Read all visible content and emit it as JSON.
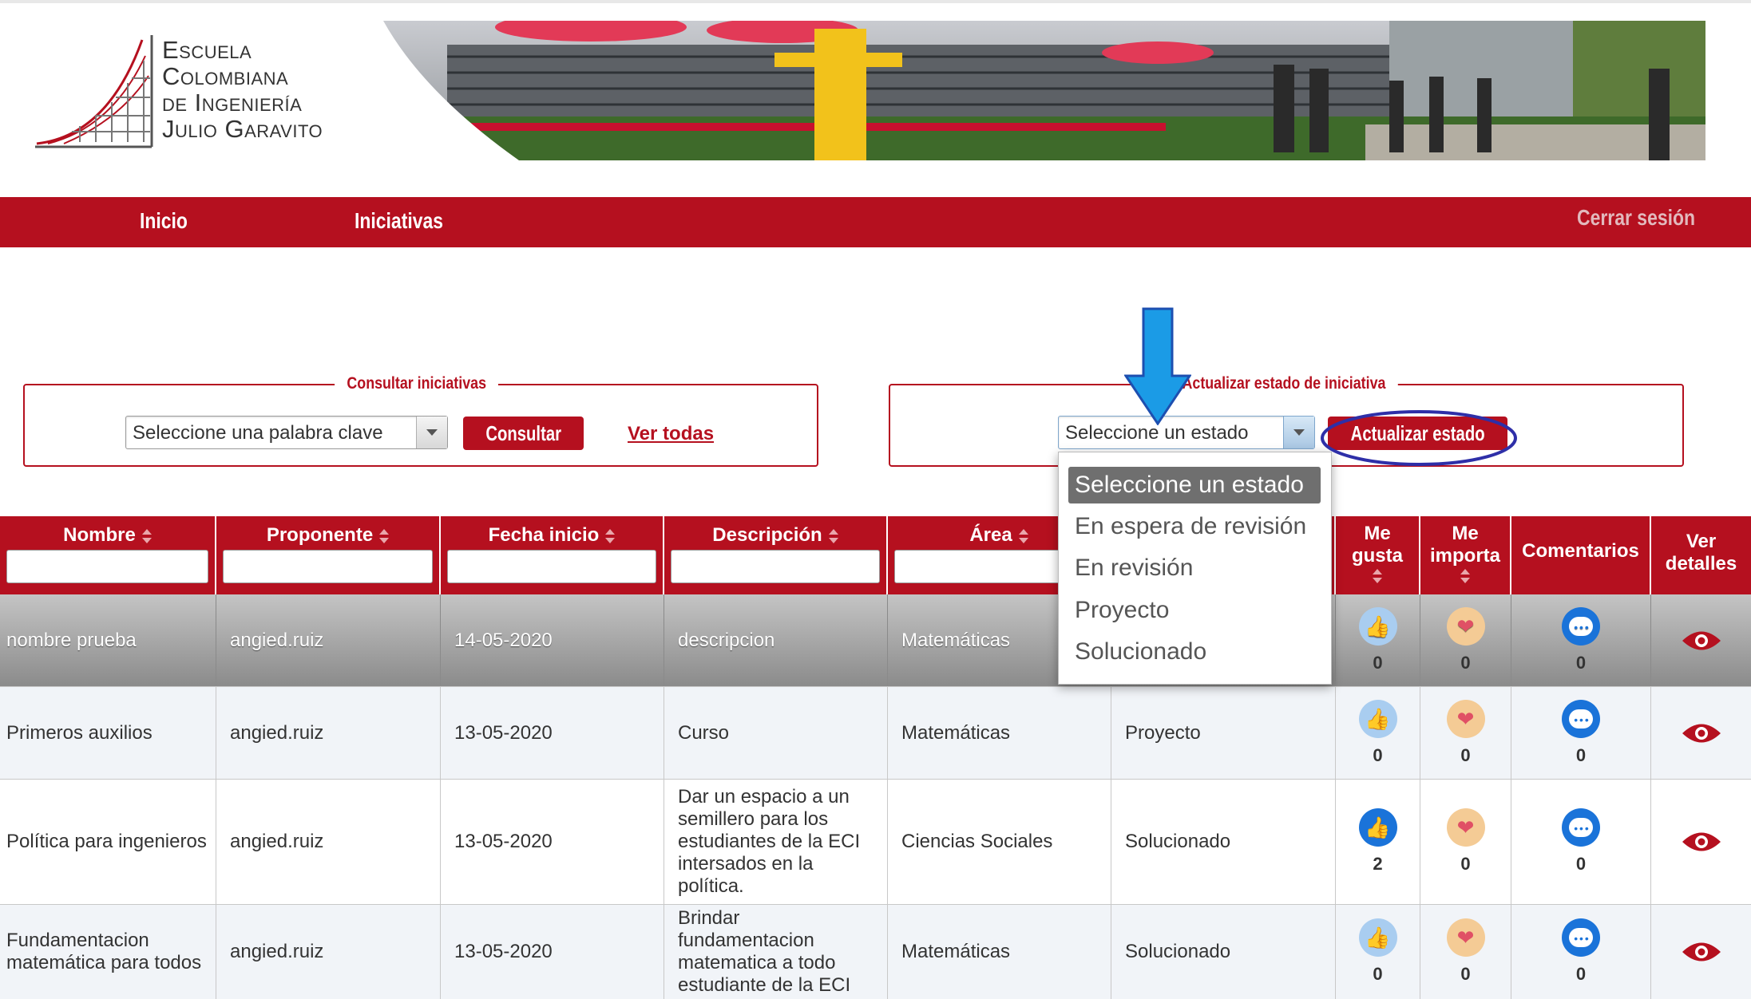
{
  "header": {
    "logo_lines": [
      "Escuela",
      "Colombiana",
      "de Ingeniería",
      "Julio Garavito"
    ]
  },
  "nav": {
    "inicio": "Inicio",
    "iniciativas": "Iniciativas",
    "cerrar_sesion": "Cerrar sesión"
  },
  "consultar": {
    "legend": "Consultar iniciativas",
    "select_value": "Seleccione una palabra clave",
    "button": "Consultar",
    "link": "Ver todas"
  },
  "actualizar": {
    "legend": "Actualizar estado de iniciativa",
    "select_value": "Seleccione un estado",
    "button": "Actualizar estado"
  },
  "dropdown": {
    "options": [
      "Seleccione un estado",
      "En espera de revisión",
      "En revisión",
      "Proyecto",
      "Solucionado"
    ],
    "highlighted": 0
  },
  "table": {
    "headers": {
      "nombre": "Nombre",
      "proponente": "Proponente",
      "fecha": "Fecha inicio",
      "descripcion": "Descripción",
      "area": "Área",
      "megusta_1": "Me",
      "megusta_2": "gusta",
      "meimporta_1": "Me",
      "meimporta_2": "importa",
      "comentarios": "Comentarios",
      "ver_1": "Ver",
      "ver_2": "detalles"
    },
    "rows": [
      {
        "nombre": "nombre prueba",
        "proponente": "angied.ruiz",
        "fecha": "14-05-2020",
        "descripcion": "descripcion",
        "area": "Matemáticas",
        "estado": "",
        "me_gusta": "0",
        "me_importa": "0",
        "comentarios": "0"
      },
      {
        "nombre": "Primeros auxilios",
        "proponente": "angied.ruiz",
        "fecha": "13-05-2020",
        "descripcion": "Curso",
        "area": "Matemáticas",
        "estado": "Proyecto",
        "me_gusta": "0",
        "me_importa": "0",
        "comentarios": "0"
      },
      {
        "nombre": "Política para ingenieros",
        "proponente": "angied.ruiz",
        "fecha": "13-05-2020",
        "descripcion": "Dar un espacio a un semillero para los estudiantes de la ECI intersados en la política.",
        "area": "Ciencias Sociales",
        "estado": "Solucionado",
        "me_gusta": "2",
        "me_importa": "0",
        "comentarios": "0"
      },
      {
        "nombre": "Fundamentacion matemática para todos",
        "proponente": "angied.ruiz",
        "fecha": "13-05-2020",
        "descripcion": "Brindar fundamentacion matematica a todo estudiante de la ECI",
        "area": "Matemáticas",
        "estado": "Solucionado",
        "me_gusta": "0",
        "me_importa": "0",
        "comentarios": "0"
      }
    ]
  },
  "colors": {
    "brand_red": "#b5101f",
    "annotation_blue": "#1b9be6",
    "annotation_oval": "#2e2fa8"
  }
}
